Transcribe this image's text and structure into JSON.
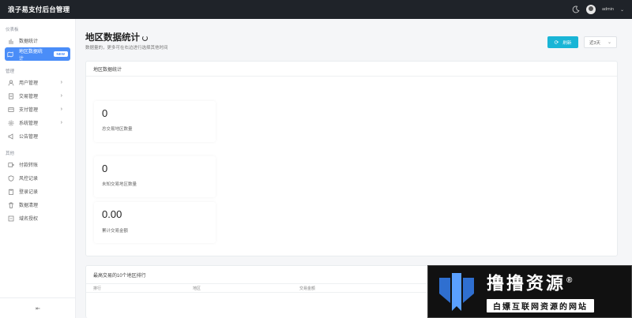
{
  "header": {
    "brand": "浪子易支付后台管理",
    "user_name": "admin",
    "user_chevron": "⌄"
  },
  "sidebar": {
    "sections": [
      {
        "title": "仪表板",
        "items": [
          {
            "label": "数据统计",
            "icon": "bar-chart-icon"
          },
          {
            "label": "地区数据统计",
            "icon": "map-icon",
            "badge": "NEW",
            "active": true
          }
        ]
      },
      {
        "title": "管理",
        "items": [
          {
            "label": "用户管理",
            "icon": "user-icon",
            "caret": "›"
          },
          {
            "label": "交易管理",
            "icon": "document-icon",
            "caret": "›"
          },
          {
            "label": "支付管理",
            "icon": "card-icon",
            "caret": "›"
          },
          {
            "label": "系统管理",
            "icon": "gear-icon",
            "caret": "›"
          },
          {
            "label": "公告管理",
            "icon": "megaphone-icon"
          }
        ]
      },
      {
        "title": "其他",
        "items": [
          {
            "label": "付款转账",
            "icon": "transfer-icon"
          },
          {
            "label": "风控记录",
            "icon": "shield-icon"
          },
          {
            "label": "登录记录",
            "icon": "clipboard-icon"
          },
          {
            "label": "数据清理",
            "icon": "trash-icon"
          },
          {
            "label": "域名授权",
            "icon": "key-icon"
          }
        ]
      }
    ],
    "collapse_glyph": "⇤"
  },
  "page": {
    "title": "地区数据统计",
    "subtitle": "数据量的，更多可在右边进行选择其他时间",
    "refresh_label": "刷新",
    "range_value": "近3天"
  },
  "region_card": {
    "title": "地区数据统计",
    "stats": [
      {
        "value": "0",
        "label": "总交易地区数量"
      },
      {
        "value": "0",
        "label": "未知交易地区数量"
      },
      {
        "value": "0.00",
        "label": "累计交易金额"
      }
    ]
  },
  "ranking_card": {
    "title": "最高交易的10个地区排行",
    "columns": [
      "排行",
      "地区",
      "交易金额"
    ]
  },
  "watermark": {
    "title": "撸撸资源",
    "reg": "®",
    "subtitle": "白嫖互联网资源的网站"
  },
  "colors": {
    "topbar": "#1f2329",
    "accent": "#4a8df8",
    "refresh": "#19b5d6"
  }
}
